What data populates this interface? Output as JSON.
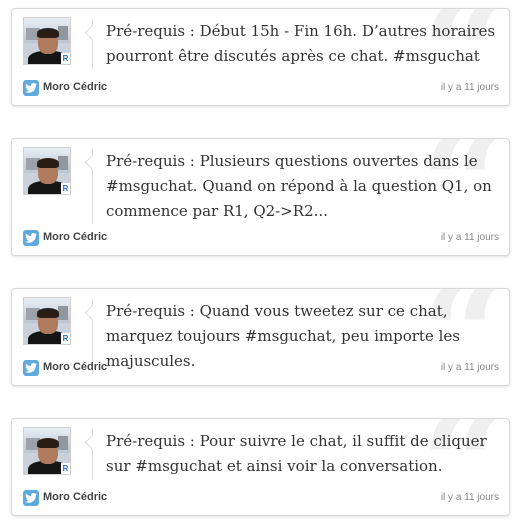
{
  "tweets": [
    {
      "text": "Pré-requis : Début 15h - Fin 16h. D’autres horaires pourront être discutés après ce chat. #msguchat",
      "author": "Moro Cédric",
      "time": "il y a 11 jours"
    },
    {
      "text": "Pré-requis : Plusieurs questions ouvertes dans le #msguchat. Quand on répond à la question Q1, on commence par R1, Q2->R2...",
      "author": "Moro Cédric",
      "time": "il y a 11 jours"
    },
    {
      "text": "Pré-requis : Quand vous tweetez sur ce chat, marquez toujours #msguchat, peu importe les majuscules.",
      "author": "Moro Cédric",
      "time": "il y a 11 jours"
    },
    {
      "text": "Pré-requis : Pour suivre le chat, il suffit de cliquer sur #msguchat et ainsi voir la conversation.",
      "author": "Moro Cédric",
      "time": "il y a 11 jours"
    }
  ],
  "quote_glyph": "“",
  "avatar_badge": "R",
  "icons": {
    "service": "twitter-bird-icon"
  },
  "colors": {
    "twitter_blue": "#5ea9dd",
    "text": "#333333",
    "border": "#d9d9d9"
  }
}
